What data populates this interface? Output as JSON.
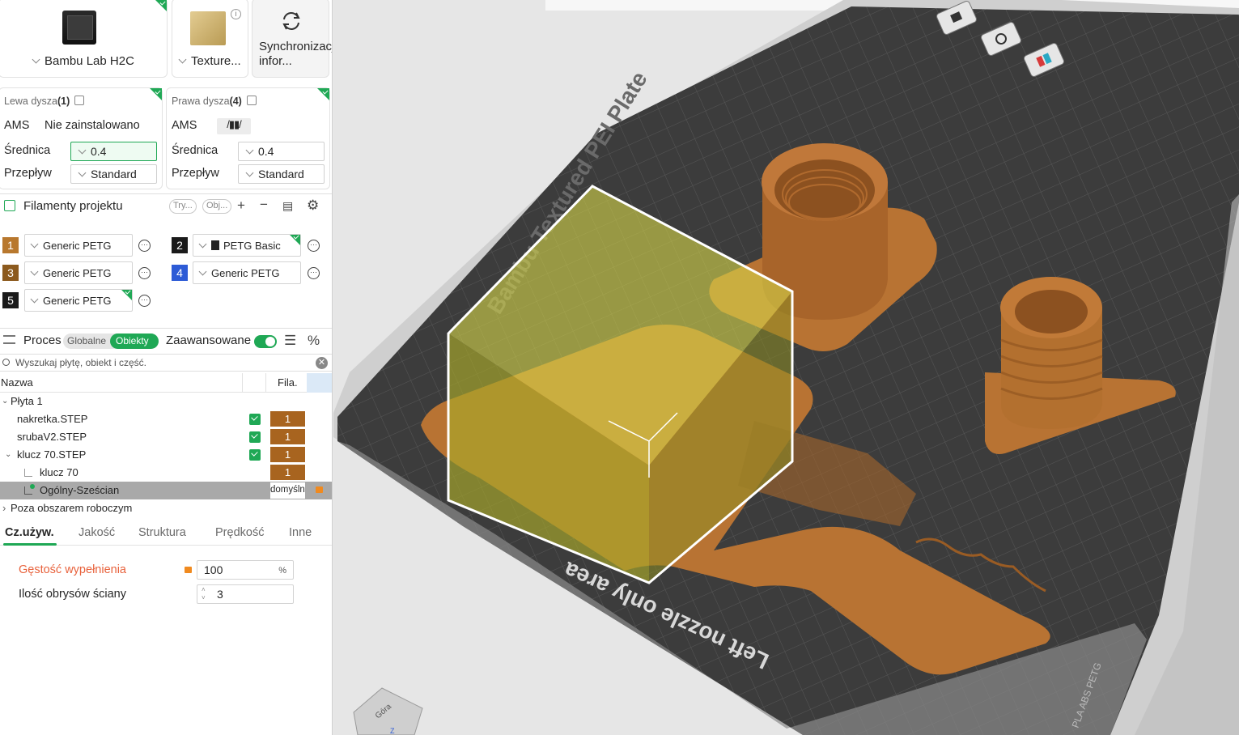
{
  "printer": {
    "name": "Bambu Lab H2C",
    "plate": "Texture...",
    "sync_label": "Synchronizacja infor..."
  },
  "nozzles": {
    "left": {
      "title": "Lewa dysza",
      "count": "(1)",
      "ams_label": "AMS",
      "ams_value": "Nie zainstalowano",
      "diameter_label": "Średnica",
      "diameter": "0.4",
      "flow_label": "Przepływ",
      "flow": "Standard"
    },
    "right": {
      "title": "Prawa dysza",
      "count": "(4)",
      "ams_label": "AMS",
      "diameter_label": "Średnica",
      "diameter": "0.4",
      "flow_label": "Przepływ",
      "flow": "Standard"
    }
  },
  "filaments": {
    "title": "Filamenty projektu",
    "pill1": "Try...",
    "pill2": "Obj...",
    "items": [
      {
        "num": "1",
        "name": "Generic PETG",
        "color": "#b8782e"
      },
      {
        "num": "2",
        "name": "PETG Basic",
        "color": "#1a1a1a"
      },
      {
        "num": "3",
        "name": "Generic PETG",
        "color": "#8c5a1e"
      },
      {
        "num": "4",
        "name": "Generic PETG",
        "color": "#2d5bd6"
      },
      {
        "num": "5",
        "name": "Generic PETG",
        "color": "#1a1a1a"
      }
    ]
  },
  "process": {
    "title": "Proces",
    "global": "Globalne",
    "objects": "Obiekty",
    "advanced": "Zaawansowane"
  },
  "search": {
    "placeholder": "Wyszukaj płytę, obiekt i część."
  },
  "tree": {
    "col_name": "Nazwa",
    "col_fila": "Fila.",
    "rows": [
      {
        "name": "Płyta 1"
      },
      {
        "name": "nakretka.STEP",
        "fila": "1"
      },
      {
        "name": "srubaV2.STEP",
        "fila": "1"
      },
      {
        "name": "klucz 70.STEP",
        "fila": "1"
      },
      {
        "name": "klucz 70",
        "fila": "1"
      },
      {
        "name": "Ogólny-Sześcian",
        "fila": "domyślne"
      },
      {
        "name": "Poza obszarem roboczym"
      }
    ]
  },
  "tabs": [
    "Cz.używ.",
    "Jakość",
    "Struktura",
    "Prędkość",
    "Inne"
  ],
  "params": {
    "infill_label": "Gęstość wypełnienia",
    "infill_value": "100",
    "infill_unit": "%",
    "walls_label": "Ilość obrysów ściany",
    "walls_value": "3"
  },
  "viewport": {
    "plate_text": "Bambu Textured PEI Plate",
    "nozzle_text": "Left nozzle only area",
    "corner_text": "PLA ABS PETG",
    "nav_cube_label": "Góra",
    "nav_cube_axis": "Z",
    "colors": {
      "object": "#b87333",
      "cube": "#d6d64a",
      "bed": "#3a3a3a"
    }
  }
}
